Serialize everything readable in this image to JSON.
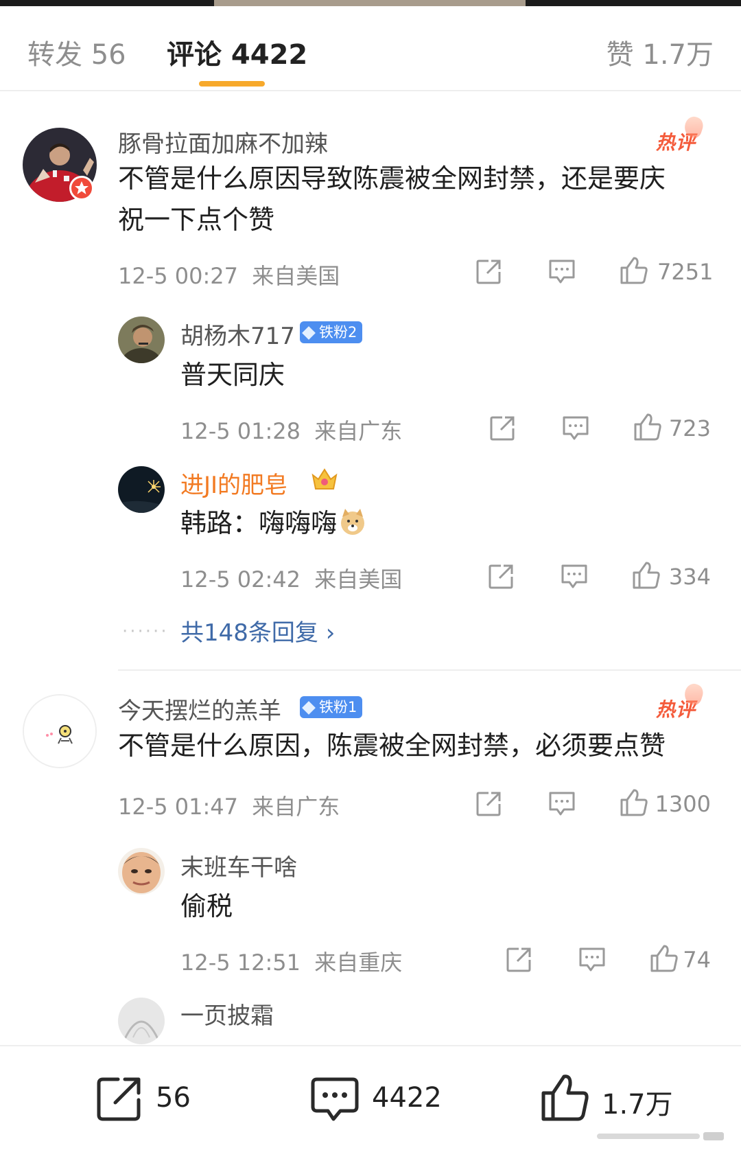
{
  "tabs": {
    "repost": "转发 56",
    "comments": "评论 4422",
    "likes": "赞 1.7万"
  },
  "hot_label": "热评",
  "comments": [
    {
      "user": "豚骨拉面加麻不加辣",
      "text_line1": "不管是什么原因导致陈震被全网封禁，还是要庆",
      "text_line2": "祝一下点个赞",
      "time": "12-5 00:27",
      "location": "来自美国",
      "likes": "7251",
      "replies": [
        {
          "user": "胡杨木717",
          "badge": "铁粉2",
          "text": "普天同庆",
          "time": "12-5 01:28",
          "location": "来自广东",
          "likes": "723"
        },
        {
          "user": "进JI的肥皂",
          "text": "韩路：嗨嗨嗨",
          "time": "12-5 02:42",
          "location": "来自美国",
          "likes": "334"
        }
      ],
      "more_replies": "共148条回复 ›"
    },
    {
      "user": "今天摆烂的羔羊",
      "badge": "铁粉1",
      "text": "不管是什么原因，陈震被全网封禁，必须要点赞",
      "time": "12-5 01:47",
      "location": "来自广东",
      "likes": "1300",
      "replies": [
        {
          "user": "末班车干啥",
          "text": "偷税",
          "time": "12-5 12:51",
          "location": "来自重庆",
          "likes": "74"
        },
        {
          "user": "一页披霜"
        }
      ]
    }
  ],
  "bottom_bar": {
    "repost": "56",
    "comments": "4422",
    "likes": "1.7万"
  },
  "colors": {
    "accent": "#f7a92b",
    "hot": "#f45b3b",
    "badge": "#4d8ef0",
    "link": "#3f6aa8",
    "vip_name": "#f27a22"
  }
}
